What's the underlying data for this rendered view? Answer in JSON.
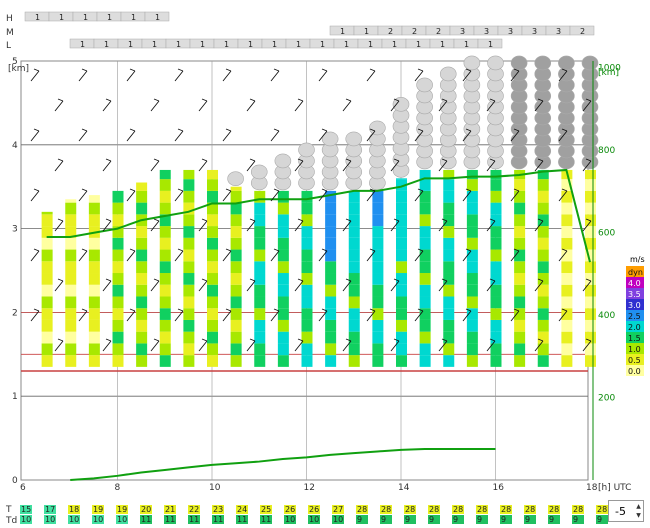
{
  "rows": {
    "high": "H",
    "mid": "M",
    "low": "L"
  },
  "axes": {
    "y_left_unit": "[km]",
    "y_right_unit": "[km]",
    "y_left_ticks": [
      "0",
      "1",
      "2",
      "3",
      "4",
      "5"
    ],
    "y_right_ticks": [
      "200",
      "400",
      "600",
      "800",
      "1000"
    ],
    "x_ticks": [
      "6",
      "8",
      "10",
      "12",
      "14",
      "16"
    ],
    "x_last": "18",
    "x_unit": "[h] UTC"
  },
  "legend": {
    "title": "m/s",
    "levels": [
      "dyn",
      "4.0",
      "3.5",
      "3.0",
      "2.5",
      "2.0",
      "1.5",
      "1.0",
      "0.5",
      "0.0"
    ],
    "colors": [
      "#ff9d00",
      "#c000c0",
      "#8040e0",
      "#3030d0",
      "#2090f0",
      "#00d8d0",
      "#10d060",
      "#a8e800",
      "#e8f020",
      "#ffffa0"
    ]
  },
  "bottom": {
    "t_label": "T",
    "td_label": "Td",
    "t_values": [
      "15",
      "17",
      "18",
      "19",
      "19",
      "20",
      "21",
      "22",
      "23",
      "24",
      "25",
      "26",
      "26",
      "27",
      "28",
      "28",
      "28",
      "28",
      "28",
      "28",
      "28",
      "28",
      "28",
      "28",
      "28"
    ],
    "td_values": [
      "10",
      "10",
      "10",
      "10",
      "10",
      "11",
      "11",
      "11",
      "11",
      "11",
      "11",
      "10",
      "10",
      "10",
      "9",
      "9",
      "9",
      "9",
      "9",
      "9",
      "9",
      "9",
      "9",
      "9",
      "9"
    ]
  },
  "offset": {
    "value": "-5"
  },
  "chart_data": {
    "type": "bar",
    "x_hours": [
      6.5,
      7,
      7.5,
      8,
      8.5,
      9,
      9.5,
      10,
      10.5,
      11,
      11.5,
      12,
      12.5,
      13,
      13.5,
      14,
      14.5,
      15,
      15.5,
      16,
      16.5,
      17,
      17.5,
      18
    ],
    "column_top_km": [
      3.2,
      3.35,
      3.4,
      3.45,
      3.55,
      3.7,
      3.7,
      3.7,
      3.5,
      3.45,
      3.45,
      3.45,
      3.45,
      3.45,
      3.45,
      3.6,
      3.7,
      3.7,
      3.7,
      3.7,
      3.7,
      3.7,
      3.7,
      3.7
    ],
    "mixing_height_km": [
      2.9,
      2.9,
      2.95,
      3.0,
      3.1,
      3.15,
      3.2,
      3.3,
      3.3,
      3.35,
      3.35,
      3.35,
      3.4,
      3.45,
      3.45,
      3.5,
      3.6,
      3.6,
      3.62,
      3.62,
      3.64,
      3.68,
      3.7,
      2.6
    ],
    "lower_line_km": [
      0.0,
      0.02,
      0.05,
      0.09,
      0.12,
      0.15,
      0.18,
      0.2,
      0.22,
      0.25,
      0.27,
      0.3,
      0.32,
      0.34,
      0.36,
      0.37,
      0.37,
      0.37,
      0.37
    ],
    "low_cloud_cover": [
      "1",
      "1",
      "1",
      "1",
      "1",
      "1",
      "1",
      "1",
      "1",
      "1",
      "1",
      "1",
      "1",
      "1",
      "1",
      "1",
      "1",
      "1"
    ],
    "mid_cloud_cover": [
      "1",
      "1",
      "2",
      "2",
      "2",
      "3",
      "3",
      "3",
      "3",
      "3",
      "2"
    ],
    "high_cloud_cover": [
      "1",
      "1",
      "1",
      "1",
      "1",
      "1"
    ],
    "temperature_c": [
      15,
      17,
      18,
      19,
      19,
      20,
      21,
      22,
      23,
      24,
      25,
      26,
      26,
      27,
      28,
      28,
      28,
      28,
      28,
      28,
      28,
      28,
      28,
      28,
      28
    ],
    "dewpoint_c": [
      10,
      10,
      10,
      10,
      10,
      11,
      11,
      11,
      11,
      11,
      11,
      10,
      10,
      10,
      9,
      9,
      9,
      9,
      9,
      9,
      9,
      9,
      9,
      9,
      9
    ],
    "ylim_km": [
      0,
      5
    ],
    "y2lim": [
      0,
      1000
    ],
    "xlim_hours": [
      6,
      18
    ]
  }
}
